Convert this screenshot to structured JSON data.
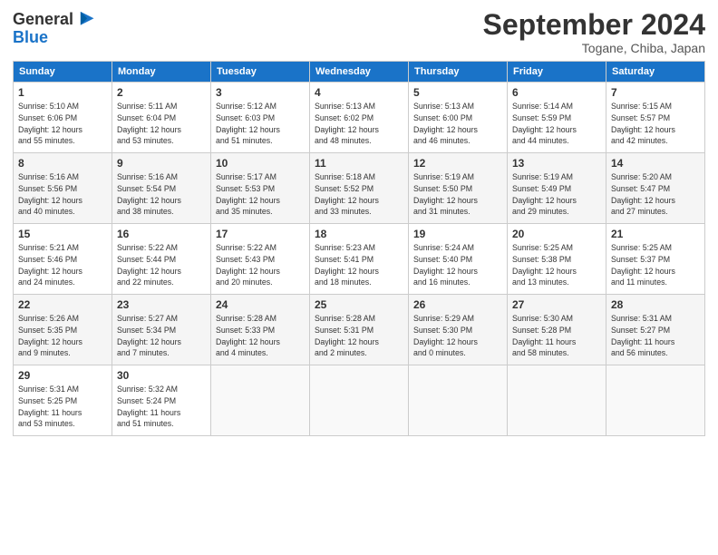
{
  "header": {
    "logo_general": "General",
    "logo_blue": "Blue",
    "month_title": "September 2024",
    "subtitle": "Togane, Chiba, Japan"
  },
  "days_of_week": [
    "Sunday",
    "Monday",
    "Tuesday",
    "Wednesday",
    "Thursday",
    "Friday",
    "Saturday"
  ],
  "weeks": [
    [
      {
        "day": "1",
        "info": "Sunrise: 5:10 AM\nSunset: 6:06 PM\nDaylight: 12 hours\nand 55 minutes."
      },
      {
        "day": "2",
        "info": "Sunrise: 5:11 AM\nSunset: 6:04 PM\nDaylight: 12 hours\nand 53 minutes."
      },
      {
        "day": "3",
        "info": "Sunrise: 5:12 AM\nSunset: 6:03 PM\nDaylight: 12 hours\nand 51 minutes."
      },
      {
        "day": "4",
        "info": "Sunrise: 5:13 AM\nSunset: 6:02 PM\nDaylight: 12 hours\nand 48 minutes."
      },
      {
        "day": "5",
        "info": "Sunrise: 5:13 AM\nSunset: 6:00 PM\nDaylight: 12 hours\nand 46 minutes."
      },
      {
        "day": "6",
        "info": "Sunrise: 5:14 AM\nSunset: 5:59 PM\nDaylight: 12 hours\nand 44 minutes."
      },
      {
        "day": "7",
        "info": "Sunrise: 5:15 AM\nSunset: 5:57 PM\nDaylight: 12 hours\nand 42 minutes."
      }
    ],
    [
      {
        "day": "8",
        "info": "Sunrise: 5:16 AM\nSunset: 5:56 PM\nDaylight: 12 hours\nand 40 minutes."
      },
      {
        "day": "9",
        "info": "Sunrise: 5:16 AM\nSunset: 5:54 PM\nDaylight: 12 hours\nand 38 minutes."
      },
      {
        "day": "10",
        "info": "Sunrise: 5:17 AM\nSunset: 5:53 PM\nDaylight: 12 hours\nand 35 minutes."
      },
      {
        "day": "11",
        "info": "Sunrise: 5:18 AM\nSunset: 5:52 PM\nDaylight: 12 hours\nand 33 minutes."
      },
      {
        "day": "12",
        "info": "Sunrise: 5:19 AM\nSunset: 5:50 PM\nDaylight: 12 hours\nand 31 minutes."
      },
      {
        "day": "13",
        "info": "Sunrise: 5:19 AM\nSunset: 5:49 PM\nDaylight: 12 hours\nand 29 minutes."
      },
      {
        "day": "14",
        "info": "Sunrise: 5:20 AM\nSunset: 5:47 PM\nDaylight: 12 hours\nand 27 minutes."
      }
    ],
    [
      {
        "day": "15",
        "info": "Sunrise: 5:21 AM\nSunset: 5:46 PM\nDaylight: 12 hours\nand 24 minutes."
      },
      {
        "day": "16",
        "info": "Sunrise: 5:22 AM\nSunset: 5:44 PM\nDaylight: 12 hours\nand 22 minutes."
      },
      {
        "day": "17",
        "info": "Sunrise: 5:22 AM\nSunset: 5:43 PM\nDaylight: 12 hours\nand 20 minutes."
      },
      {
        "day": "18",
        "info": "Sunrise: 5:23 AM\nSunset: 5:41 PM\nDaylight: 12 hours\nand 18 minutes."
      },
      {
        "day": "19",
        "info": "Sunrise: 5:24 AM\nSunset: 5:40 PM\nDaylight: 12 hours\nand 16 minutes."
      },
      {
        "day": "20",
        "info": "Sunrise: 5:25 AM\nSunset: 5:38 PM\nDaylight: 12 hours\nand 13 minutes."
      },
      {
        "day": "21",
        "info": "Sunrise: 5:25 AM\nSunset: 5:37 PM\nDaylight: 12 hours\nand 11 minutes."
      }
    ],
    [
      {
        "day": "22",
        "info": "Sunrise: 5:26 AM\nSunset: 5:35 PM\nDaylight: 12 hours\nand 9 minutes."
      },
      {
        "day": "23",
        "info": "Sunrise: 5:27 AM\nSunset: 5:34 PM\nDaylight: 12 hours\nand 7 minutes."
      },
      {
        "day": "24",
        "info": "Sunrise: 5:28 AM\nSunset: 5:33 PM\nDaylight: 12 hours\nand 4 minutes."
      },
      {
        "day": "25",
        "info": "Sunrise: 5:28 AM\nSunset: 5:31 PM\nDaylight: 12 hours\nand 2 minutes."
      },
      {
        "day": "26",
        "info": "Sunrise: 5:29 AM\nSunset: 5:30 PM\nDaylight: 12 hours\nand 0 minutes."
      },
      {
        "day": "27",
        "info": "Sunrise: 5:30 AM\nSunset: 5:28 PM\nDaylight: 11 hours\nand 58 minutes."
      },
      {
        "day": "28",
        "info": "Sunrise: 5:31 AM\nSunset: 5:27 PM\nDaylight: 11 hours\nand 56 minutes."
      }
    ],
    [
      {
        "day": "29",
        "info": "Sunrise: 5:31 AM\nSunset: 5:25 PM\nDaylight: 11 hours\nand 53 minutes."
      },
      {
        "day": "30",
        "info": "Sunrise: 5:32 AM\nSunset: 5:24 PM\nDaylight: 11 hours\nand 51 minutes."
      },
      {
        "day": "",
        "info": ""
      },
      {
        "day": "",
        "info": ""
      },
      {
        "day": "",
        "info": ""
      },
      {
        "day": "",
        "info": ""
      },
      {
        "day": "",
        "info": ""
      }
    ]
  ]
}
